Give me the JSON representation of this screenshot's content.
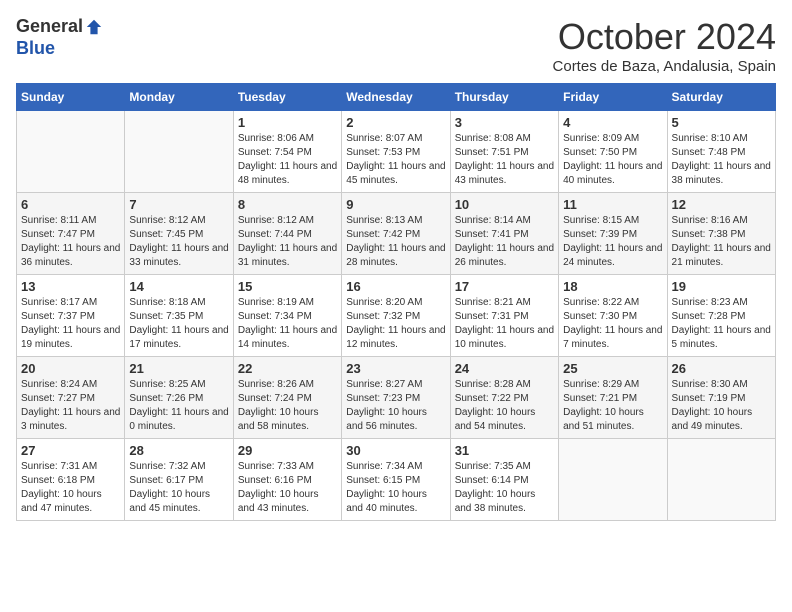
{
  "header": {
    "logo_general": "General",
    "logo_blue": "Blue",
    "month_title": "October 2024",
    "subtitle": "Cortes de Baza, Andalusia, Spain"
  },
  "days_of_week": [
    "Sunday",
    "Monday",
    "Tuesday",
    "Wednesday",
    "Thursday",
    "Friday",
    "Saturday"
  ],
  "weeks": [
    [
      {
        "day": "",
        "info": ""
      },
      {
        "day": "",
        "info": ""
      },
      {
        "day": "1",
        "info": "Sunrise: 8:06 AM\nSunset: 7:54 PM\nDaylight: 11 hours and 48 minutes."
      },
      {
        "day": "2",
        "info": "Sunrise: 8:07 AM\nSunset: 7:53 PM\nDaylight: 11 hours and 45 minutes."
      },
      {
        "day": "3",
        "info": "Sunrise: 8:08 AM\nSunset: 7:51 PM\nDaylight: 11 hours and 43 minutes."
      },
      {
        "day": "4",
        "info": "Sunrise: 8:09 AM\nSunset: 7:50 PM\nDaylight: 11 hours and 40 minutes."
      },
      {
        "day": "5",
        "info": "Sunrise: 8:10 AM\nSunset: 7:48 PM\nDaylight: 11 hours and 38 minutes."
      }
    ],
    [
      {
        "day": "6",
        "info": "Sunrise: 8:11 AM\nSunset: 7:47 PM\nDaylight: 11 hours and 36 minutes."
      },
      {
        "day": "7",
        "info": "Sunrise: 8:12 AM\nSunset: 7:45 PM\nDaylight: 11 hours and 33 minutes."
      },
      {
        "day": "8",
        "info": "Sunrise: 8:12 AM\nSunset: 7:44 PM\nDaylight: 11 hours and 31 minutes."
      },
      {
        "day": "9",
        "info": "Sunrise: 8:13 AM\nSunset: 7:42 PM\nDaylight: 11 hours and 28 minutes."
      },
      {
        "day": "10",
        "info": "Sunrise: 8:14 AM\nSunset: 7:41 PM\nDaylight: 11 hours and 26 minutes."
      },
      {
        "day": "11",
        "info": "Sunrise: 8:15 AM\nSunset: 7:39 PM\nDaylight: 11 hours and 24 minutes."
      },
      {
        "day": "12",
        "info": "Sunrise: 8:16 AM\nSunset: 7:38 PM\nDaylight: 11 hours and 21 minutes."
      }
    ],
    [
      {
        "day": "13",
        "info": "Sunrise: 8:17 AM\nSunset: 7:37 PM\nDaylight: 11 hours and 19 minutes."
      },
      {
        "day": "14",
        "info": "Sunrise: 8:18 AM\nSunset: 7:35 PM\nDaylight: 11 hours and 17 minutes."
      },
      {
        "day": "15",
        "info": "Sunrise: 8:19 AM\nSunset: 7:34 PM\nDaylight: 11 hours and 14 minutes."
      },
      {
        "day": "16",
        "info": "Sunrise: 8:20 AM\nSunset: 7:32 PM\nDaylight: 11 hours and 12 minutes."
      },
      {
        "day": "17",
        "info": "Sunrise: 8:21 AM\nSunset: 7:31 PM\nDaylight: 11 hours and 10 minutes."
      },
      {
        "day": "18",
        "info": "Sunrise: 8:22 AM\nSunset: 7:30 PM\nDaylight: 11 hours and 7 minutes."
      },
      {
        "day": "19",
        "info": "Sunrise: 8:23 AM\nSunset: 7:28 PM\nDaylight: 11 hours and 5 minutes."
      }
    ],
    [
      {
        "day": "20",
        "info": "Sunrise: 8:24 AM\nSunset: 7:27 PM\nDaylight: 11 hours and 3 minutes."
      },
      {
        "day": "21",
        "info": "Sunrise: 8:25 AM\nSunset: 7:26 PM\nDaylight: 11 hours and 0 minutes."
      },
      {
        "day": "22",
        "info": "Sunrise: 8:26 AM\nSunset: 7:24 PM\nDaylight: 10 hours and 58 minutes."
      },
      {
        "day": "23",
        "info": "Sunrise: 8:27 AM\nSunset: 7:23 PM\nDaylight: 10 hours and 56 minutes."
      },
      {
        "day": "24",
        "info": "Sunrise: 8:28 AM\nSunset: 7:22 PM\nDaylight: 10 hours and 54 minutes."
      },
      {
        "day": "25",
        "info": "Sunrise: 8:29 AM\nSunset: 7:21 PM\nDaylight: 10 hours and 51 minutes."
      },
      {
        "day": "26",
        "info": "Sunrise: 8:30 AM\nSunset: 7:19 PM\nDaylight: 10 hours and 49 minutes."
      }
    ],
    [
      {
        "day": "27",
        "info": "Sunrise: 7:31 AM\nSunset: 6:18 PM\nDaylight: 10 hours and 47 minutes."
      },
      {
        "day": "28",
        "info": "Sunrise: 7:32 AM\nSunset: 6:17 PM\nDaylight: 10 hours and 45 minutes."
      },
      {
        "day": "29",
        "info": "Sunrise: 7:33 AM\nSunset: 6:16 PM\nDaylight: 10 hours and 43 minutes."
      },
      {
        "day": "30",
        "info": "Sunrise: 7:34 AM\nSunset: 6:15 PM\nDaylight: 10 hours and 40 minutes."
      },
      {
        "day": "31",
        "info": "Sunrise: 7:35 AM\nSunset: 6:14 PM\nDaylight: 10 hours and 38 minutes."
      },
      {
        "day": "",
        "info": ""
      },
      {
        "day": "",
        "info": ""
      }
    ]
  ]
}
